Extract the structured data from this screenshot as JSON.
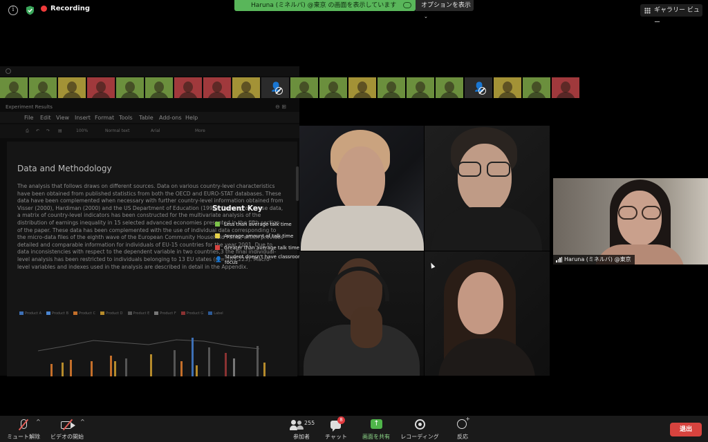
{
  "topbar": {
    "info_icon": "info-icon",
    "security_icon": "shield-check-icon",
    "recording_label": "Recording",
    "recording_color": "#ef3b3b",
    "share_banner": "Haruna (ミネルバ) @東京 の画面を表示しています",
    "share_banner_color": "#59b65a",
    "options_label": "オプションを表示",
    "gallery_label": "ギャラリー ビュー"
  },
  "shared_screen": {
    "thumbnail_strip": [
      "green",
      "green",
      "yellow",
      "red",
      "green",
      "green",
      "red",
      "red",
      "yellow",
      "off",
      "green",
      "green",
      "yellow",
      "green",
      "green",
      "green",
      "off",
      "yellow",
      "green",
      "red"
    ],
    "experiment_label": "Experiment Results",
    "menu": [
      "File",
      "Edit",
      "View",
      "Insert",
      "Format",
      "Tools",
      "Table",
      "Add-ons",
      "Help"
    ],
    "toolbar": {
      "zoom": "100%",
      "style": "Normal text",
      "font": "Arial",
      "more": "More"
    },
    "doc_heading": "Data and Methodology",
    "doc_body": "The analysis that follows draws on different sources. Data on various country-level characteristics have been obtained from published statistics from both the OECD and EURO-STAT databases. These data have been complemented when necessary with further country-level information obtained from Visser (2000), Hardiman (2000) and the US Department of Education (1996). Drawing on these data, a matrix of country-level indicators has been constructed for the multivariate analysis of the distribution of earnings inequality in 15 selected advanced economies presented in the fifth section of the paper. These data has been complemented with the use of individual data corresponding to the micro-data files of the eighth wave of the European Community Household Panel, which provides detailed and comparable information for individuals of EU-15 countries for the year 2001. Due to data inconsistencies with respect to the dependent variable in two countries,3 the final individual-level analysis has been restricted to individuals belonging to 13 EU states (n = 103,223). Macro-level variables and indexes used in the analysis are described in detail in the Appendix.",
    "chart_legend": [
      "Product A",
      "Product B",
      "Product C",
      "Product D",
      "Product E",
      "Product F",
      "Product G",
      "Label"
    ],
    "student_key": {
      "title": "Student Key",
      "items": [
        {
          "label": "Less than average talk time",
          "color": "#7cc24a"
        },
        {
          "label": "Average amount of talk time",
          "color": "#e5d04a"
        },
        {
          "label": "Greater than average talk time",
          "color": "#d64541"
        },
        {
          "label": "Student doesn't have classroom in focus",
          "icon": "person-off-icon"
        }
      ]
    }
  },
  "videos": {
    "active_speaker_name": "Haruna (ミネルバ) @東京"
  },
  "bottom_bar": {
    "mute_label": "ミュート解除",
    "video_label": "ビデオの開始",
    "participants_label": "参加者",
    "participants_count": "255",
    "chat_label": "チャット",
    "chat_badge": "8",
    "share_label": "画面を共有",
    "share_color": "#4fb54a",
    "record_label": "レコーディング",
    "reactions_label": "反応",
    "leave_label": "退出",
    "leave_color": "#d7433e"
  }
}
